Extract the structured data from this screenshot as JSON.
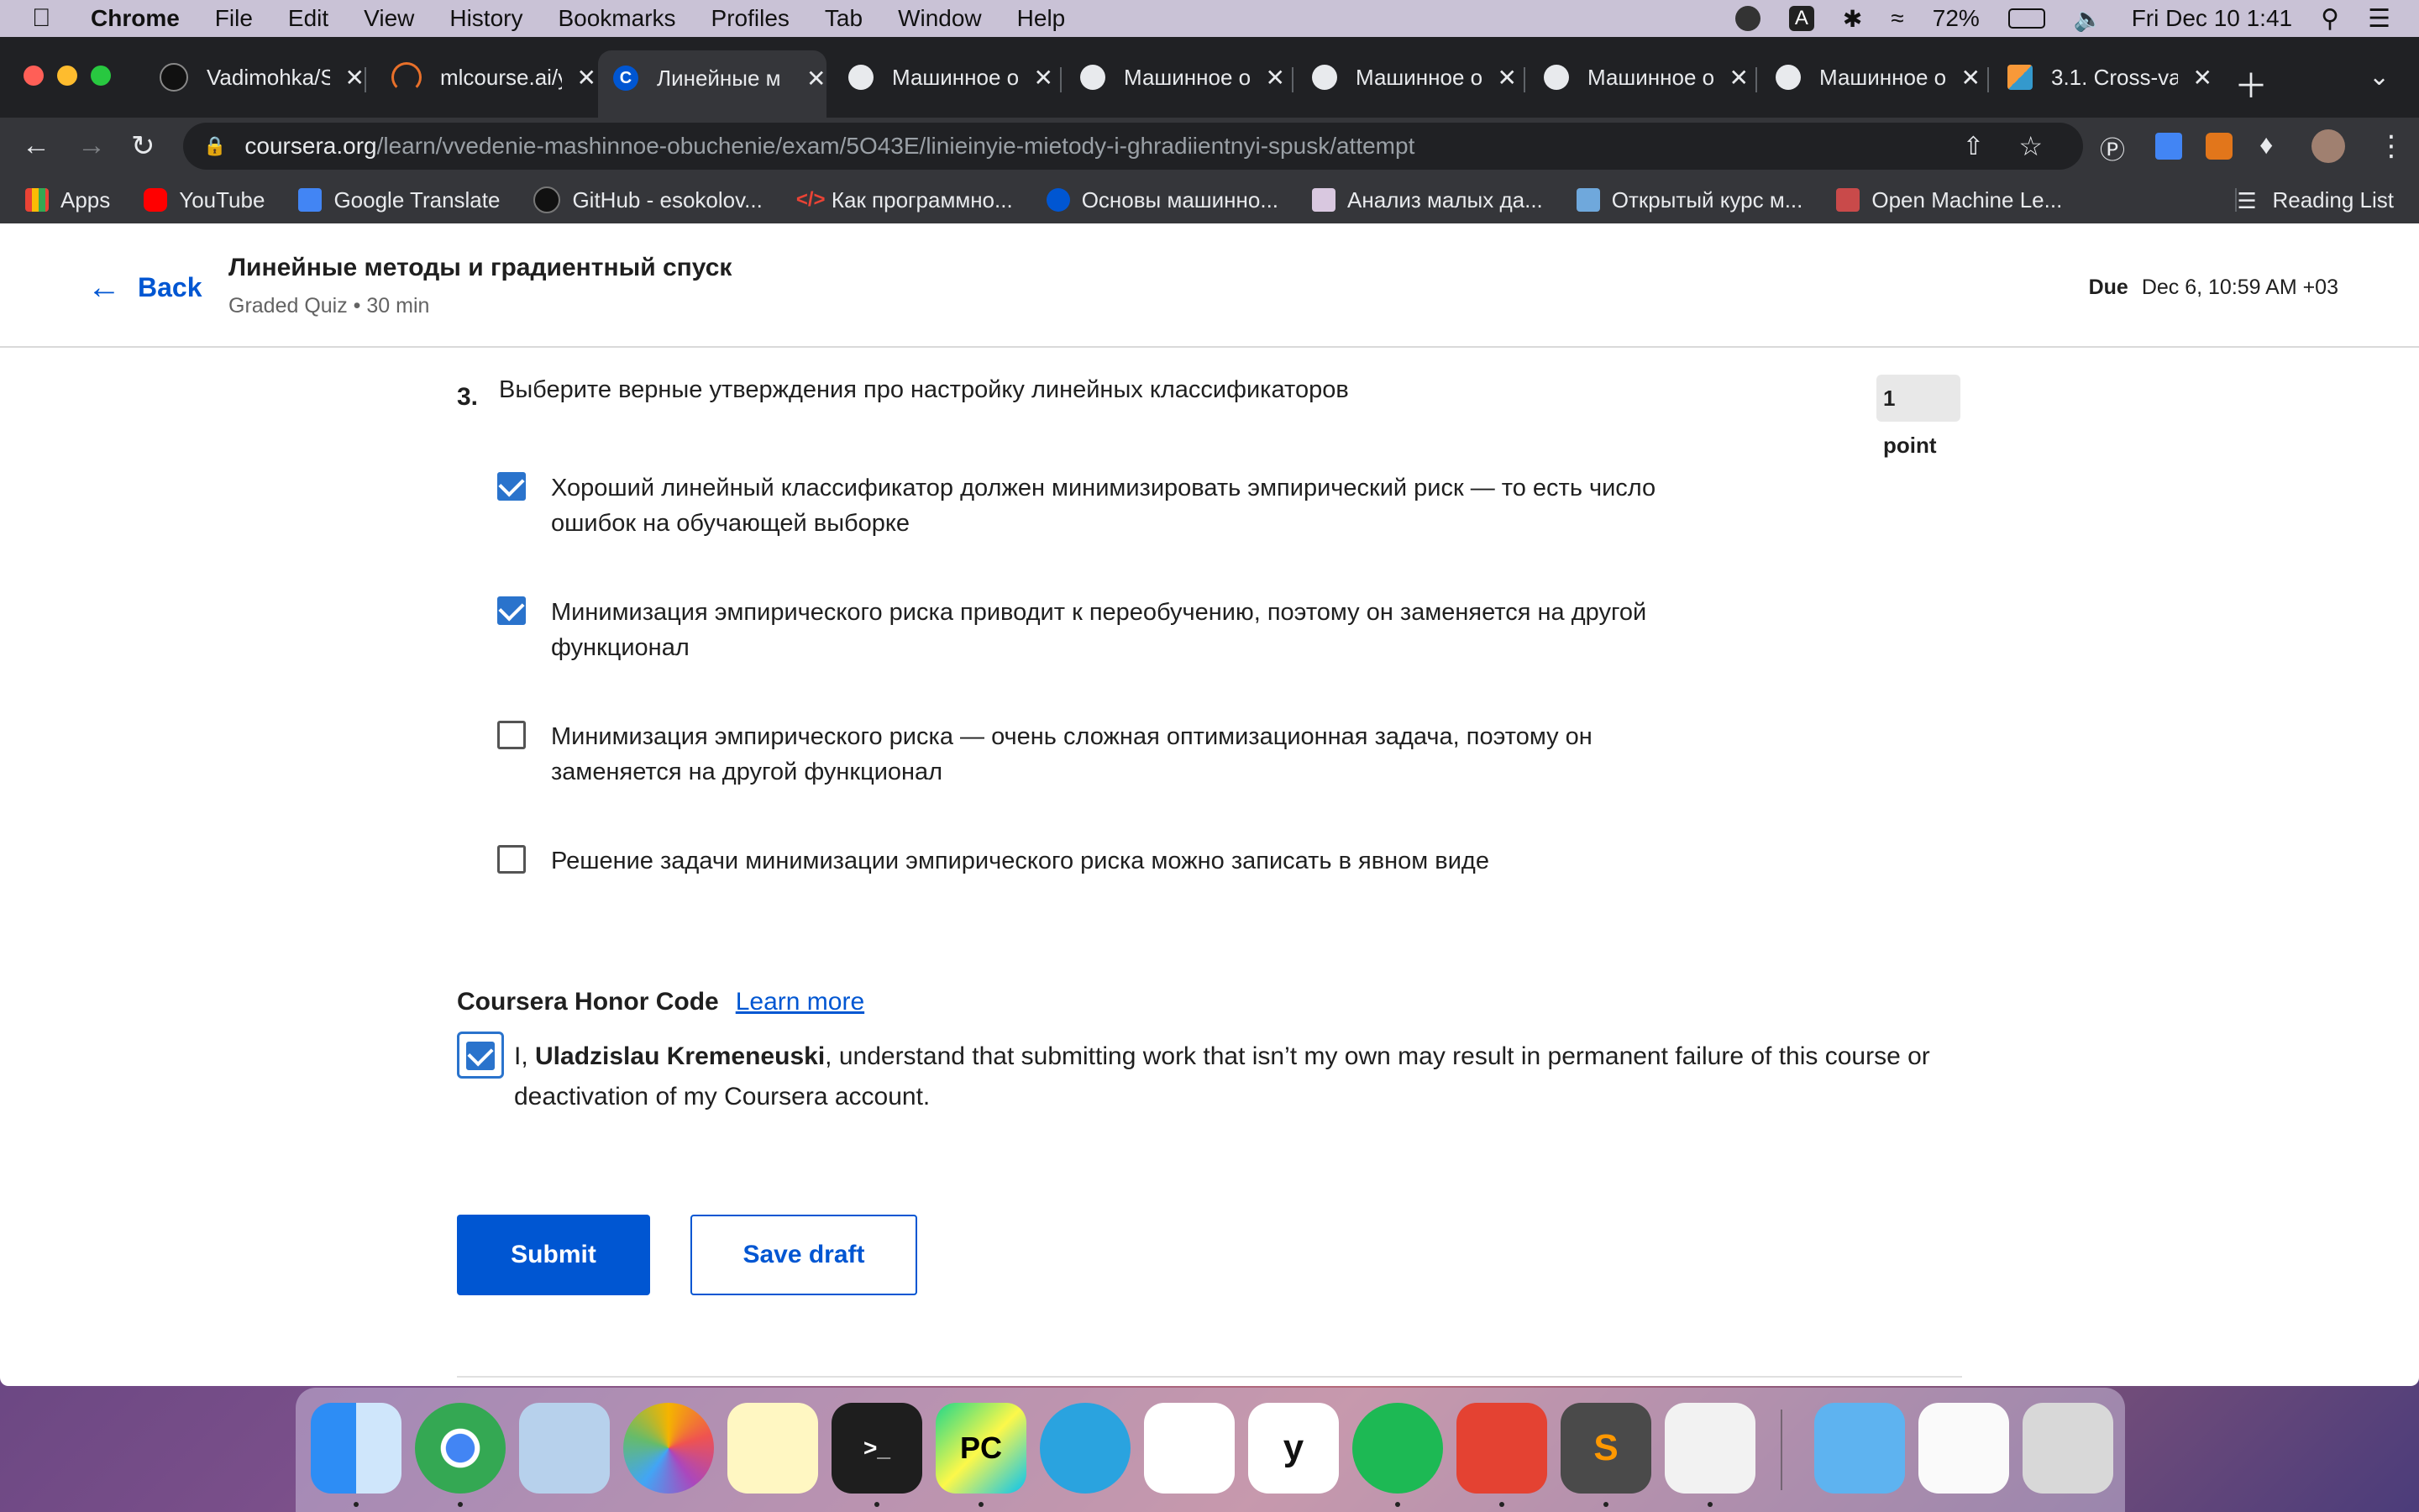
{
  "menubar": {
    "app": "Chrome",
    "menus": [
      "File",
      "Edit",
      "View",
      "History",
      "Bookmarks",
      "Profiles",
      "Tab",
      "Window",
      "Help"
    ],
    "battery": "72%",
    "clock": "Fri Dec 10  1:41",
    "icons": [
      "creative-cloud-icon",
      "input-source-icon",
      "bluetooth-icon",
      "wifi-icon",
      "battery-icon",
      "volume-icon",
      "spotlight-icon",
      "control-center-icon"
    ]
  },
  "tabs": [
    {
      "title": "Vadimohka/S",
      "icon": "github-icon"
    },
    {
      "title": "mlcourse.ai/y",
      "icon": "mlcourse-icon"
    },
    {
      "title": "Линейные м",
      "icon": "coursera-icon",
      "active": true
    },
    {
      "title": "Машинное о",
      "icon": "globe-icon"
    },
    {
      "title": "Машинное о",
      "icon": "globe-icon"
    },
    {
      "title": "Машинное о",
      "icon": "globe-icon"
    },
    {
      "title": "Машинное о",
      "icon": "globe-icon"
    },
    {
      "title": "Машинное о",
      "icon": "globe-icon"
    },
    {
      "title": "3.1. Cross-va",
      "icon": "sklearn-icon"
    }
  ],
  "address": {
    "host": "coursera.org",
    "path": "/learn/vvedenie-mashinnoe-obuchenie/exam/5O43E/linieinyie-mietody-i-ghradiientnyi-spusk/attempt"
  },
  "bookmarks": [
    {
      "label": "Apps",
      "icon": "apps-grid-icon"
    },
    {
      "label": "YouTube",
      "icon": "youtube-icon"
    },
    {
      "label": "Google Translate",
      "icon": "google-translate-icon"
    },
    {
      "label": "GitHub - esokolov...",
      "icon": "github-icon"
    },
    {
      "label": "Как программно...",
      "icon": "code-icon"
    },
    {
      "label": "Основы машинно...",
      "icon": "coursera-icon"
    },
    {
      "label": "Анализ малых да...",
      "icon": "chart-icon"
    },
    {
      "label": "Открытый курс м...",
      "icon": "star-badge-icon"
    },
    {
      "label": "Open Machine Le...",
      "icon": "ods-icon"
    }
  ],
  "reading_list": "Reading List",
  "header": {
    "back": "Back",
    "title": "Линейные методы и градиентный спуск",
    "meta": "Graded Quiz • 30 min",
    "due_label": "Due",
    "due_value": "Dec 6, 10:59 AM +03"
  },
  "question": {
    "number": "3.",
    "text": "Выберите верные утверждения про настройку линейных классификаторов",
    "points": "1 point",
    "options": [
      {
        "text": "Хороший линейный классификатор должен минимизировать эмпирический риск — то есть число ошибок на обучающей выборке",
        "checked": true
      },
      {
        "text": "Минимизация эмпирического риска приводит к переобучению, поэтому он заменяется на другой функционал",
        "checked": true
      },
      {
        "text": "Минимизация эмпирического риска — очень сложная оптимизационная задача, поэтому он заменяется на другой функционал",
        "checked": false
      },
      {
        "text": "Решение задачи минимизации эмпирического риска можно записать в явном виде",
        "checked": false
      }
    ]
  },
  "honor": {
    "title": "Coursera Honor Code",
    "link": "Learn more",
    "prefix": "I, ",
    "name": "Uladzislau Kremeneuski",
    "suffix": ", understand that submitting work that isn’t my own may result in permanent failure of this course or deactivation of my Coursera account.",
    "checked": true
  },
  "actions": {
    "submit": "Submit",
    "save_draft": "Save draft"
  },
  "dock": [
    "finder-icon",
    "chrome-icon",
    "mail-icon",
    "photos-icon",
    "notes-icon",
    "terminal-icon",
    "pycharm-icon",
    "telegram-icon",
    "slack-icon",
    "yandex-icon",
    "spotify-icon",
    "todoist-icon",
    "sublime-icon",
    "textedit-icon",
    "folder-icon",
    "document-icon",
    "trash-icon"
  ],
  "colors": {
    "accent": "#0056d2",
    "checkbox": "#2a73cc"
  }
}
